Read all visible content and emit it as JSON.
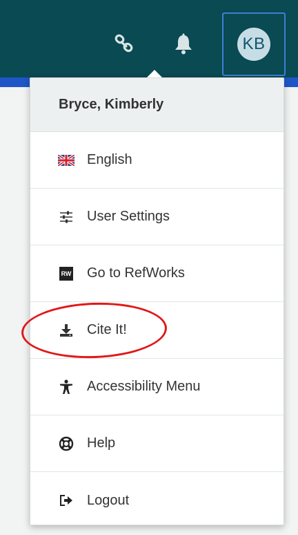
{
  "header": {
    "link_icon": "link-icon",
    "bell_icon": "bell-icon",
    "avatar_initials": "KB"
  },
  "menu": {
    "user_name": "Bryce, Kimberly",
    "items": [
      {
        "label": "English",
        "icon": "uk-flag-icon"
      },
      {
        "label": "User Settings",
        "icon": "sliders-icon"
      },
      {
        "label": "Go to RefWorks",
        "icon": "refworks-icon",
        "badge": "RW"
      },
      {
        "label": "Cite It!",
        "icon": "download-icon"
      },
      {
        "label": "Accessibility Menu",
        "icon": "accessibility-icon"
      },
      {
        "label": "Help",
        "icon": "lifebuoy-icon"
      },
      {
        "label": "Logout",
        "icon": "logout-icon"
      }
    ]
  },
  "colors": {
    "topbar": "#0a4a52",
    "accent_strip": "#1e56c7",
    "highlight": "#e01818"
  }
}
